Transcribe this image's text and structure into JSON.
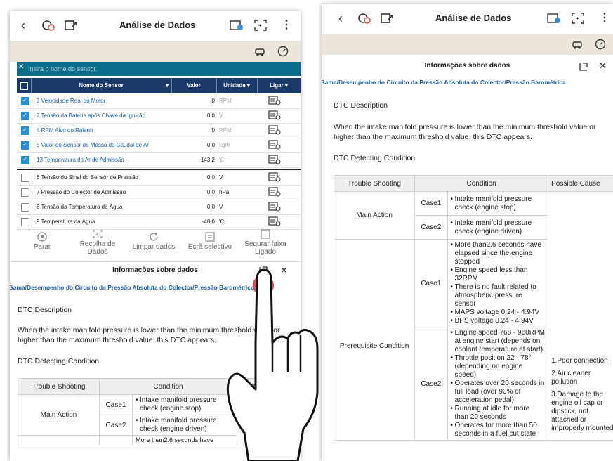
{
  "app": {
    "title": "Análise de Dados",
    "menu_glyph": "⋮",
    "back_glyph": "‹",
    "close_glyph": "✕"
  },
  "search": {
    "placeholder": "Insira o nome do sensor."
  },
  "table": {
    "headers": {
      "name": "Nome do Sensor",
      "value": "Valor",
      "unit": "Unidade",
      "link": "Ligar"
    },
    "rows": [
      {
        "name": "3 Velocidade Real do Motor",
        "value": "0",
        "unit": "RPM",
        "checked": true
      },
      {
        "name": "2 Tensão da Bateria após Chave da Ignição",
        "value": "0.0",
        "unit": "V",
        "checked": true
      },
      {
        "name": "4 RPM Alvo do Ralenti",
        "value": "0",
        "unit": "RPM",
        "checked": true
      },
      {
        "name": "5 Valor do Sensor de Massa do Caudal de Ar",
        "value": "0.0",
        "unit": "kg/h",
        "checked": true
      },
      {
        "name": "13 Temperatura do Ar de Admissão",
        "value": "143.2",
        "unit": "'C",
        "checked": true
      },
      {
        "name": "6 Tensão do Sinal do Sensor de Pressão",
        "value": "0.0",
        "unit": "V",
        "checked": false
      },
      {
        "name": "7 Pressão do Colector de Admissão",
        "value": "0.0",
        "unit": "hPa",
        "checked": false
      },
      {
        "name": "8 Tensão da Temperatura da Água",
        "value": "0.0",
        "unit": "V",
        "checked": false
      },
      {
        "name": "9 Temperatura da Água",
        "value": "-48.0",
        "unit": "'C",
        "checked": false
      }
    ]
  },
  "toolbar": {
    "stop": "Parar",
    "record": "Recolha de Dados",
    "clear": "Limpar dados",
    "select_screen": "Ecrã selectivo",
    "hold": "Segurar faixa Ligado"
  },
  "info": {
    "header": "Informações sobre dados",
    "dtc_title": "Gama/Desempenho do Circuito da Pressão Absoluta do Colector/Pressão Barométrica",
    "desc_heading": "DTC Description",
    "desc_line1": "When the intake manifold pressure is lower than the minimum threshold value or",
    "desc_line2": "higher than the maximum threshold value, this DTC appears.",
    "detect_heading": "DTC Detecting Condition",
    "col_trouble": "Trouble Shooting",
    "col_condition": "Condition",
    "col_cause": "Possible Cause",
    "main_action": "Main Action",
    "prereq": "Prerequisite Condition",
    "case1": "Case1",
    "case2": "Case2",
    "main_case1": "Intake manifold pressure check (engine stop)",
    "main_case2": "Intake manifold pressure check (engine driven)",
    "pre_case1": [
      "More than2.6 seconds have elapsed since the engine stopped",
      "Engine speed less than 32RPM",
      "There is no fault related to atmospheric pressure sensor",
      "MAPS voltage 0.24 - 4.94V",
      "BPS voltage 0.24 - 4.94V"
    ],
    "pre_case2": [
      "Engine speed 768 - 960RPM at engine start (depends on coolant temperature at start)",
      "Throttle position 22 - 78° (depending on engine speed)",
      "Operates over 20 seconds in full load (over 90% of acceleration pedal)",
      "Running at idle for more than 20 seconds",
      "Operates for more than 50 seconds in a fuel cut state"
    ],
    "causes": [
      "1.Poor connection",
      "2.Air cleaner pollution",
      "3.Damage to the engine oil cap or dipstick, not attached or improperly mounted"
    ],
    "partial_row": "More than2.6 seconds have"
  },
  "colors": {
    "header_navy": "#1b3a6b",
    "search_teal": "#0c6d8d",
    "beige_bar": "#ece6dc",
    "link_blue": "#1f5ea8",
    "touch_red": "#e5323b"
  }
}
